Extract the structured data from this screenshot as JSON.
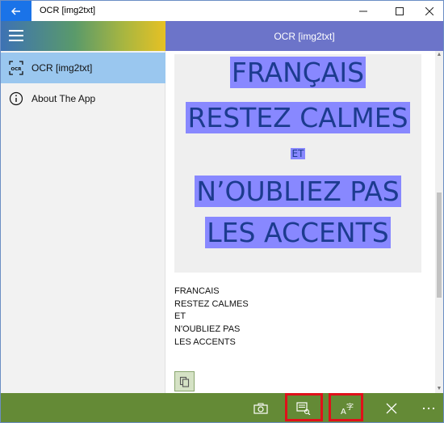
{
  "window": {
    "title": "OCR [img2txt]"
  },
  "nav": {
    "items": [
      {
        "label": "OCR [img2txt]",
        "icon": "ocr-icon",
        "active": true
      },
      {
        "label": "About The App",
        "icon": "info-icon",
        "active": false
      }
    ]
  },
  "header": {
    "title": "OCR [img2txt]"
  },
  "image": {
    "lines": [
      "FRANÇAIS",
      "RESTEZ CALMES",
      "ET",
      "N’OUBLIEZ PAS",
      "LES ACCENTS"
    ]
  },
  "result": {
    "lines": [
      "FRANCAIS",
      "RESTEZ CALMES",
      "ET",
      "N'OUBLIEZ PAS",
      "LES ACCENTS"
    ]
  },
  "appbar": {
    "buttons": [
      "camera-icon",
      "scan-image-icon",
      "text-format-icon",
      "close-icon",
      "more-icon"
    ]
  },
  "colors": {
    "title_back": "#1a73e8",
    "header": "#6c74c9",
    "nav_active": "#9ac7ef",
    "appbar": "#648a36",
    "ocr_highlight": "#8888ff",
    "ocr_text": "#1c3b8f",
    "highlight_box": "#e0101a"
  }
}
